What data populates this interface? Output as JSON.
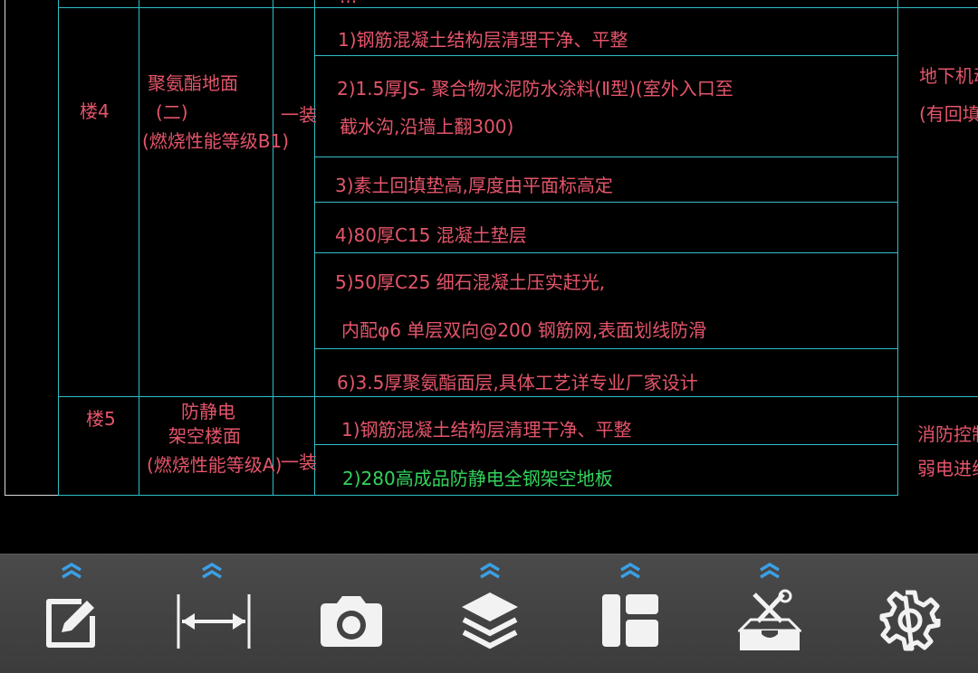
{
  "drawing": {
    "top_partial_text": "...",
    "rows": [
      {
        "code": "楼4",
        "name_lines": [
          "聚氨酯地面",
          "(二)",
          "(燃烧性能等级B1)"
        ],
        "grade": "一装",
        "steps": [
          "1)钢筋混凝土结构层清理干净、平整",
          "2)1.5厚JS- 聚合物水泥防水涂料(Ⅱ型)(室外入口至",
          "截水沟,沿墙上翻300)",
          "3)素土回填垫高,厚度由平面标高定",
          "4)80厚C15 混凝土垫层",
          "5)50厚C25 细石混凝土压实赶光,",
          "内配φ6 单层双向@200 钢筋网,表面划线防滑",
          "6)3.5厚聚氨酯面层,具体工艺详专业厂家设计"
        ],
        "notes": [
          "地下机动",
          "(有回填"
        ]
      },
      {
        "code": "楼5",
        "name_lines": [
          "防静电",
          "架空楼面",
          "(燃烧性能等级A)"
        ],
        "grade": "一装",
        "steps": [
          "1)钢筋混凝土结构层清理干净、平整",
          "2)280高成品防静电全钢架空地板"
        ],
        "notes": [
          "消防控制",
          "弱电进线"
        ]
      }
    ]
  },
  "toolbar": {
    "items": [
      {
        "name": "edit-icon",
        "has_expand": true
      },
      {
        "name": "measure-icon",
        "has_expand": true
      },
      {
        "name": "camera-icon",
        "has_expand": false
      },
      {
        "name": "layers-icon",
        "has_expand": true
      },
      {
        "name": "layout-icon",
        "has_expand": true
      },
      {
        "name": "toolbox-icon",
        "has_expand": true
      },
      {
        "name": "settings-icon",
        "has_expand": false
      }
    ]
  },
  "colors": {
    "background": "#000000",
    "grid_line": "#2fbfc5",
    "cad_text": "#e4556a",
    "cad_text_highlight": "#34d35c",
    "toolbar_bg": "#434343",
    "toolbar_icon": "#f2f2f2",
    "expand_chevron": "#3aa0e6"
  }
}
